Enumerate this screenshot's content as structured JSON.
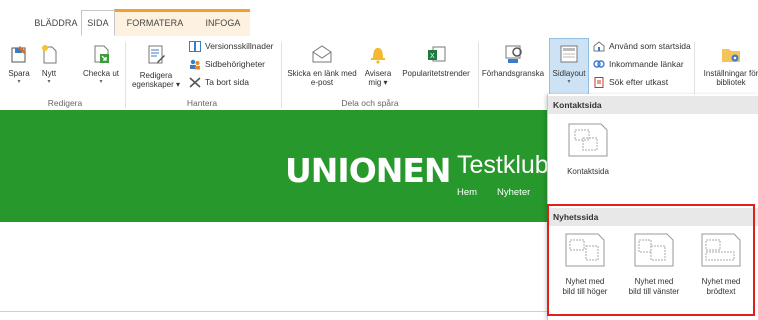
{
  "tabs": [
    {
      "label": "BLÄDDRA"
    },
    {
      "label": "SIDA"
    },
    {
      "label": "FORMATERA TEXT"
    },
    {
      "label": "INFOGA"
    }
  ],
  "ribbon": {
    "redigera": {
      "spara": "Spara",
      "nytt": "Nytt",
      "checka_ut": "Checka ut",
      "group": "Redigera"
    },
    "hantera": {
      "redigera_egenskaper_1": "Redigera",
      "redigera_egenskaper_2": "egenskaper",
      "versionsskillnader": "Versionsskillnader",
      "sidbehorigheter": "Sidbehörigheter",
      "ta_bort_sida": "Ta bort sida",
      "group": "Hantera"
    },
    "dela": {
      "skicka_1": "Skicka en länk med",
      "skicka_2": "e-post",
      "avisera_1": "Avisera",
      "avisera_2": "mig",
      "popularitet": "Popularitetstrender",
      "group": "Dela och spåra"
    },
    "forhandsgranska": "Förhandsgranska",
    "sidlayout": "Sidlayout",
    "anvand_som_startsida": "Använd som startsida",
    "inkommande_lankar": "Inkommande länkar",
    "sok_efter_utkast": "Sök efter utkast",
    "installningar_1": "Inställningar för",
    "installningar_2": "bibliotek"
  },
  "site": {
    "logo": "UNIONEN",
    "title": "Testklub",
    "nav": [
      "Hem",
      "Nyheter"
    ]
  },
  "dropdown": {
    "kontaktsida_header": "Kontaktsida",
    "kontaktsida_item": "Kontaktsida",
    "nyhetssida_header": "Nyhetssida",
    "items": [
      {
        "line1": "Nyhet med",
        "line2": "bild till höger"
      },
      {
        "line1": "Nyhet med",
        "line2": "bild till vänster"
      },
      {
        "line1": "Nyhet med",
        "line2": "brödtext"
      }
    ]
  },
  "colors": {
    "green": "#27982b",
    "context_tab": "#f0a030",
    "highlight_red": "#e0201c",
    "selected_blue": "#cde3f5"
  }
}
